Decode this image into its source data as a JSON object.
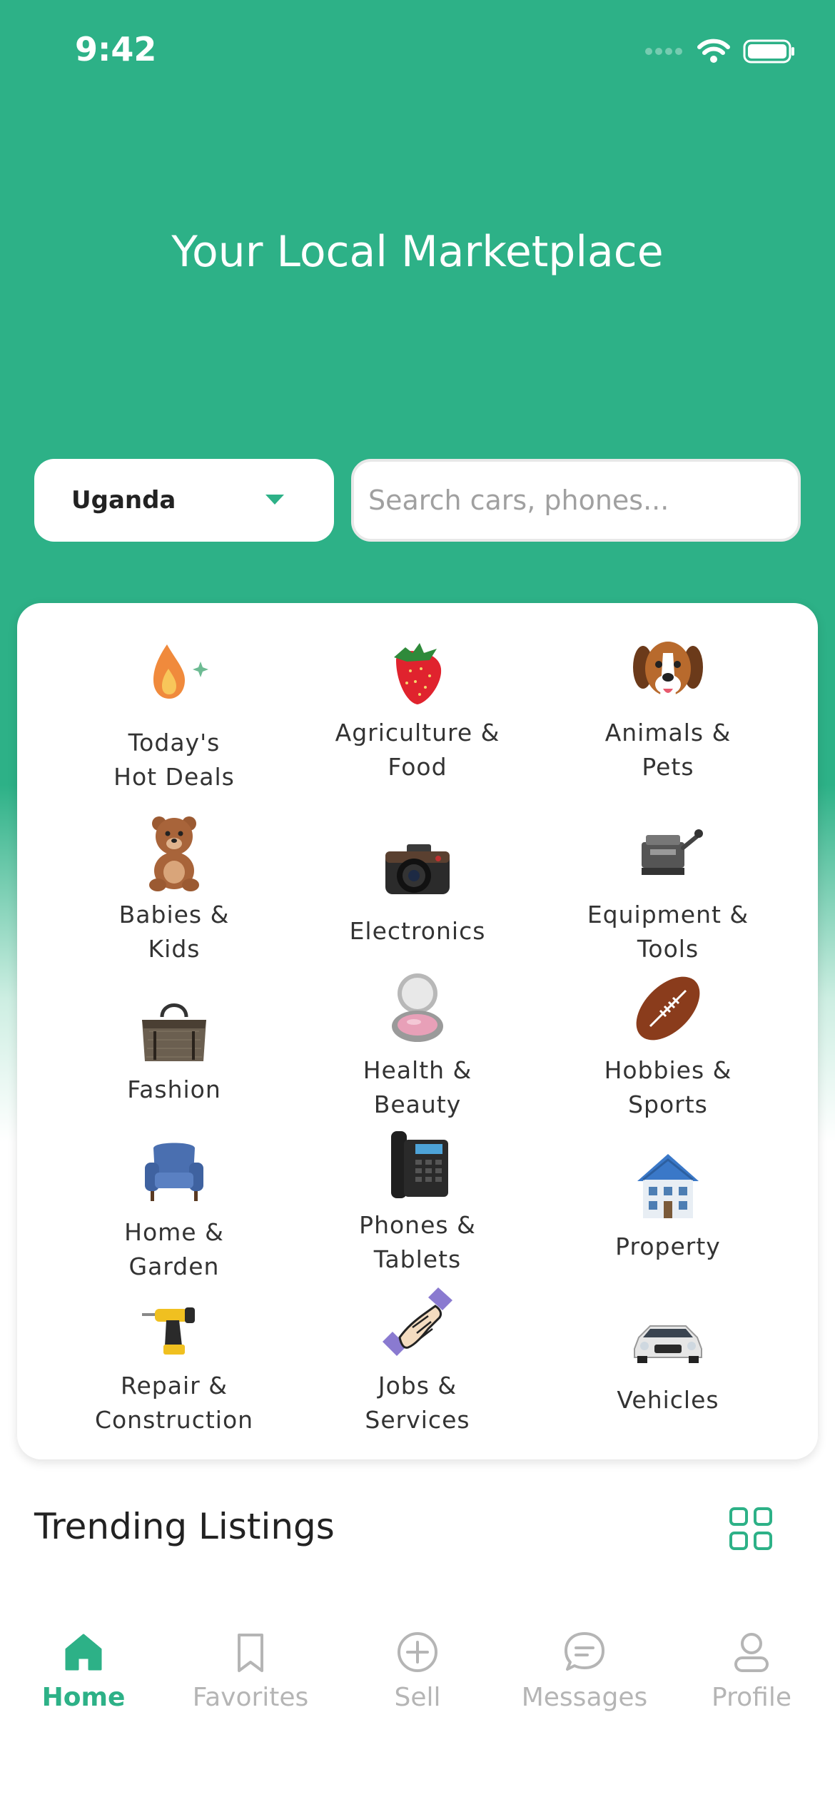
{
  "status_bar": {
    "time": "9:42"
  },
  "hero": {
    "title": "Your Local Marketplace"
  },
  "country_select": {
    "value": "Uganda"
  },
  "search": {
    "placeholder": "Search cars, phones..."
  },
  "categories": [
    {
      "label": "Today's\nHot Deals",
      "icon": "flame-icon"
    },
    {
      "label": "Agriculture &\nFood",
      "icon": "strawberry-icon"
    },
    {
      "label": "Animals &\nPets",
      "icon": "dog-icon"
    },
    {
      "label": "Babies &\nKids",
      "icon": "teddy-bear-icon"
    },
    {
      "label": "Electronics",
      "icon": "camera-icon"
    },
    {
      "label": "Equipment &\nTools",
      "icon": "machine-icon"
    },
    {
      "label": "Fashion",
      "icon": "handbag-icon"
    },
    {
      "label": "Health &\nBeauty",
      "icon": "compact-mirror-icon"
    },
    {
      "label": "Hobbies &\nSports",
      "icon": "football-icon"
    },
    {
      "label": "Home &\nGarden",
      "icon": "armchair-icon"
    },
    {
      "label": "Phones &\nTablets",
      "icon": "desk-phone-icon"
    },
    {
      "label": "Property",
      "icon": "house-icon"
    },
    {
      "label": "Repair &\nConstruction",
      "icon": "drill-icon"
    },
    {
      "label": "Jobs &\nServices",
      "icon": "handshake-icon"
    },
    {
      "label": "Vehicles",
      "icon": "car-icon"
    }
  ],
  "trending": {
    "title": "Trending Listings"
  },
  "tab_bar": {
    "tabs": [
      {
        "label": "Home",
        "icon": "home-icon",
        "active": true
      },
      {
        "label": "Favorites",
        "icon": "bookmark-icon",
        "active": false
      },
      {
        "label": "Sell",
        "icon": "plus-circle-icon",
        "active": false
      },
      {
        "label": "Messages",
        "icon": "chat-bubble-icon",
        "active": false
      },
      {
        "label": "Profile",
        "icon": "user-icon",
        "active": false
      }
    ]
  },
  "colors": {
    "brand": "#2db187",
    "tab_inactive": "#b5b5b5"
  }
}
